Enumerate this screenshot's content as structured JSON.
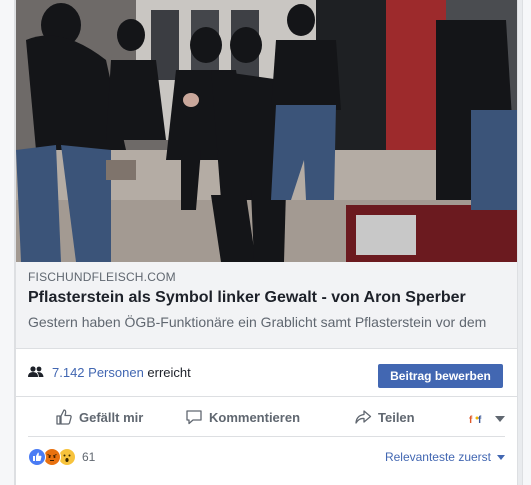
{
  "link": {
    "domain": "FISCHUNDFLEISCH.COM",
    "title": "Pflasterstein als Symbol linker Gewalt - von Aron Sperber",
    "description": "Gestern haben ÖGB-Funktionäre ein Grablicht samt Pflasterstein vor dem"
  },
  "reach": {
    "count": "7.142 Personen",
    "suffix": " erreicht",
    "promote_label": "Beitrag bewerben"
  },
  "actions": {
    "like": "Gefällt mir",
    "comment": "Kommentieren",
    "share": "Teilen"
  },
  "reactions": {
    "count": "61",
    "types": [
      "like-reaction-icon",
      "angry-reaction-icon",
      "wow-reaction-icon"
    ],
    "sort_label": "Relevanteste zuerst"
  },
  "colors": {
    "accent": "#4267b2",
    "muted": "#606770",
    "text": "#1d2129"
  }
}
